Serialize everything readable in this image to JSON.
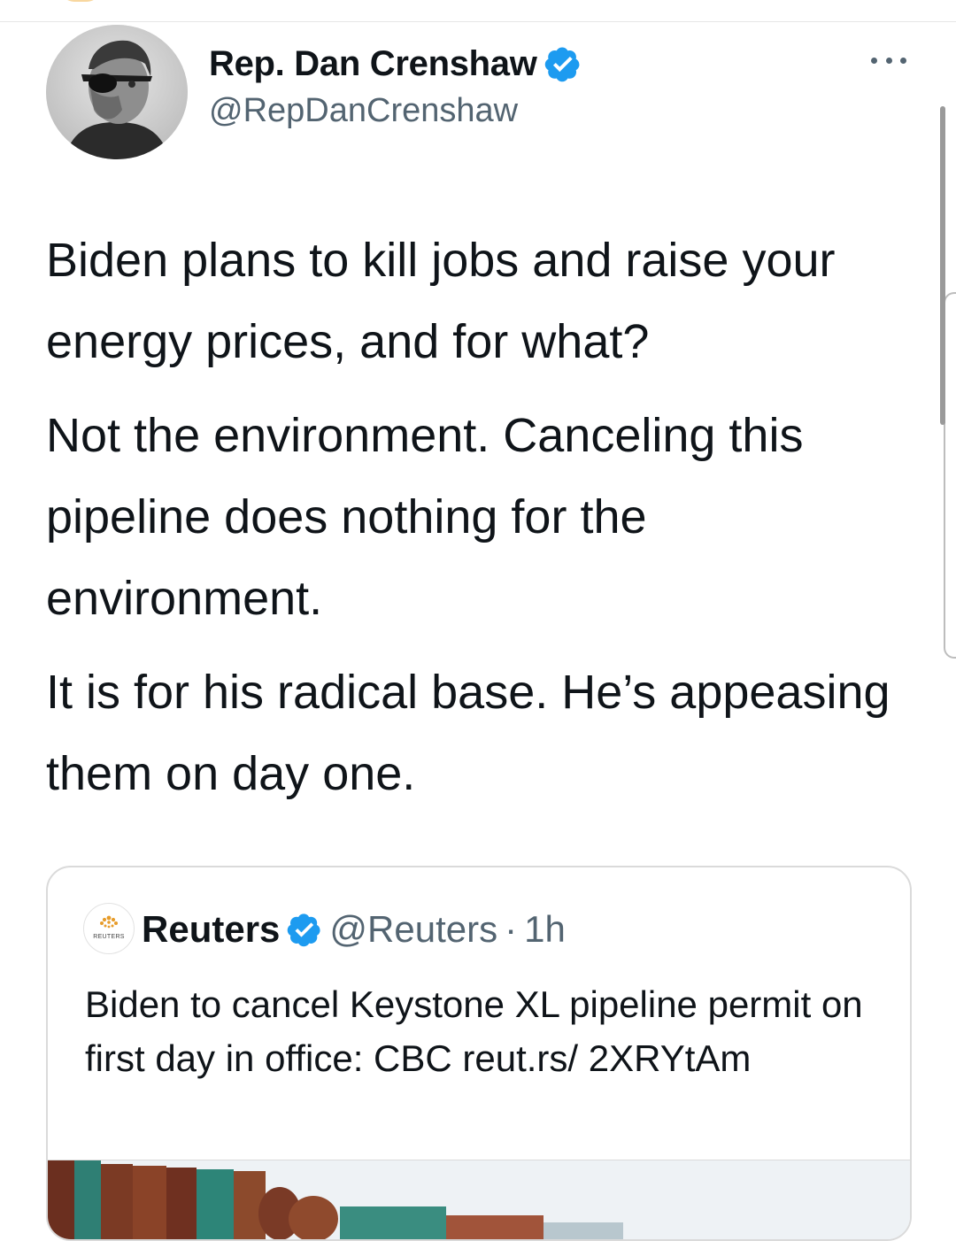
{
  "author": {
    "display_name": "Rep. Dan Crenshaw",
    "handle": "@RepDanCrenshaw",
    "verified_icon": "verified-badge-icon"
  },
  "tweet": {
    "paragraphs": [
      "Biden plans to kill jobs and raise your energy prices, and for what?",
      "Not the environment. Canceling this pipeline does nothing for the environment.",
      "It is for his radical base. He’s appeasing them on day one."
    ]
  },
  "quoted_tweet": {
    "logo_text": "REUTERS",
    "display_name": "Reuters",
    "handle": "@Reuters",
    "separator": "·",
    "time": "1h",
    "text": "Biden to cancel Keystone XL pipeline permit on first day in office: CBC reut.rs/ 2XRYtAm"
  },
  "colors": {
    "text": "#0f1419",
    "secondary_text": "#536471",
    "verified": "#1d9bf0",
    "border": "#dadada"
  },
  "icons": [
    "verified-badge-icon",
    "more-options-icon"
  ]
}
